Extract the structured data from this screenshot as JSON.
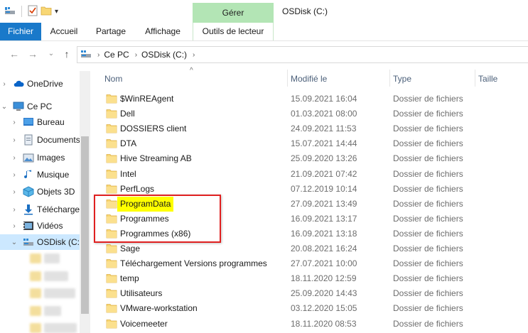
{
  "title_bar": {
    "manage_tab": "Gérer",
    "window_title": "OSDisk (C:)"
  },
  "ribbon": {
    "tabs": [
      {
        "label": "Fichier"
      },
      {
        "label": "Accueil"
      },
      {
        "label": "Partage"
      },
      {
        "label": "Affichage"
      },
      {
        "label": "Outils de lecteur"
      }
    ]
  },
  "address_bar": {
    "crumbs": [
      "Ce PC",
      "OSDisk (C:)"
    ]
  },
  "nav_pane": {
    "items": [
      {
        "label": "OneDrive",
        "icon": "cloud-icon"
      },
      {
        "label": "Ce PC",
        "icon": "computer-icon"
      },
      {
        "label": "Bureau",
        "icon": "desktop-icon"
      },
      {
        "label": "Documents",
        "icon": "documents-icon"
      },
      {
        "label": "Images",
        "icon": "images-icon"
      },
      {
        "label": "Musique",
        "icon": "music-icon"
      },
      {
        "label": "Objets 3D",
        "icon": "objects-3d-icon"
      },
      {
        "label": "Téléchargements",
        "icon": "download-icon"
      },
      {
        "label": "Vidéos",
        "icon": "videos-icon"
      },
      {
        "label": "OSDisk (C:)",
        "icon": "drive-icon"
      }
    ]
  },
  "columns": {
    "name": "Nom",
    "modified": "Modifié le",
    "type": "Type",
    "size": "Taille"
  },
  "files": [
    {
      "name": "$WinREAgent",
      "modified": "15.09.2021 16:04",
      "type": "Dossier de fichiers"
    },
    {
      "name": "Dell",
      "modified": "01.03.2021 08:00",
      "type": "Dossier de fichiers"
    },
    {
      "name": "DOSSIERS client",
      "modified": "24.09.2021 11:53",
      "type": "Dossier de fichiers"
    },
    {
      "name": "DTA",
      "modified": "15.07.2021 14:44",
      "type": "Dossier de fichiers"
    },
    {
      "name": "Hive Streaming AB",
      "modified": "25.09.2020 13:26",
      "type": "Dossier de fichiers"
    },
    {
      "name": "Intel",
      "modified": "21.09.2021 07:42",
      "type": "Dossier de fichiers"
    },
    {
      "name": "PerfLogs",
      "modified": "07.12.2019 10:14",
      "type": "Dossier de fichiers"
    },
    {
      "name": "ProgramData",
      "modified": "27.09.2021 13:49",
      "type": "Dossier de fichiers"
    },
    {
      "name": "Programmes",
      "modified": "16.09.2021 13:17",
      "type": "Dossier de fichiers"
    },
    {
      "name": "Programmes (x86)",
      "modified": "16.09.2021 13:18",
      "type": "Dossier de fichiers"
    },
    {
      "name": "Sage",
      "modified": "20.08.2021 16:24",
      "type": "Dossier de fichiers"
    },
    {
      "name": "Téléchargement Versions programmes",
      "modified": "27.07.2021 10:00",
      "type": "Dossier de fichiers"
    },
    {
      "name": "temp",
      "modified": "18.11.2020 12:59",
      "type": "Dossier de fichiers"
    },
    {
      "name": "Utilisateurs",
      "modified": "25.09.2020 14:43",
      "type": "Dossier de fichiers"
    },
    {
      "name": "VMware-workstation",
      "modified": "03.12.2020 15:05",
      "type": "Dossier de fichiers"
    },
    {
      "name": "Voicemeeter",
      "modified": "18.11.2020 08:53",
      "type": "Dossier de fichiers"
    }
  ],
  "colors": {
    "accent": "#1979ca",
    "manage_tab": "#b3e5b5",
    "selection": "#cce8ff",
    "highlight": "#ffff00",
    "annotation": "#e02020",
    "folder": "#f8d775"
  }
}
